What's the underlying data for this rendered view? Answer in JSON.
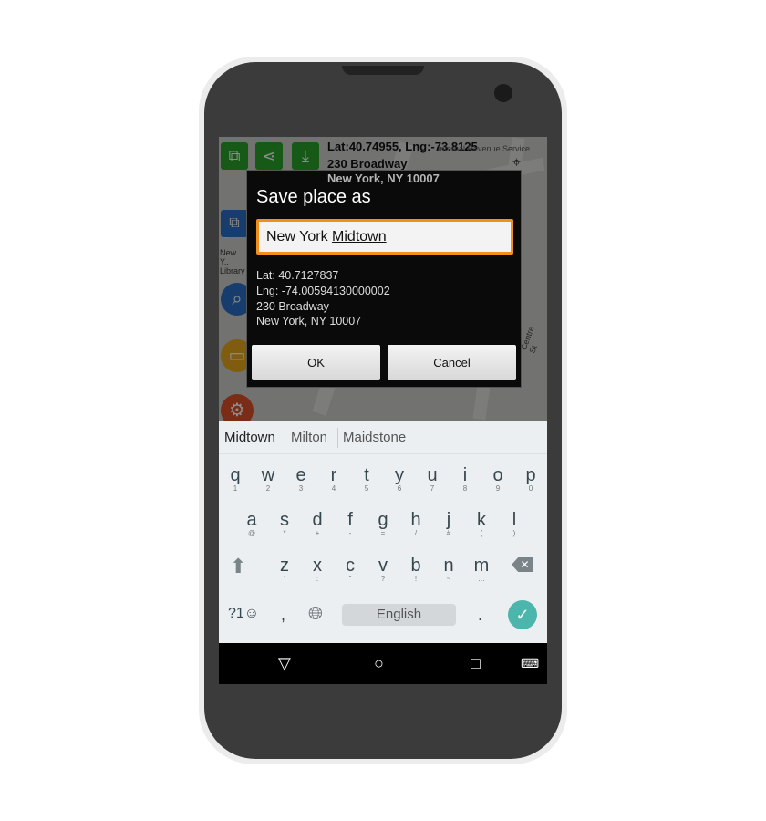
{
  "map": {
    "coords": "Lat:40.74955, Lng:-73.8125",
    "address1": "230 Broadway",
    "address2": "New York, NY 10007",
    "poi": "Internal Revenue Service",
    "side_label": "New Y.. Library",
    "street": "Centre St"
  },
  "dialog": {
    "title": "Save place as",
    "input_value_prefix": "New York ",
    "input_value_composing": "Midtown",
    "lat": "Lat: 40.7127837",
    "lng": "Lng: -74.00594130000002",
    "address1": "230 Broadway",
    "address2": "New York, NY 10007",
    "ok_label": "OK",
    "cancel_label": "Cancel",
    "accent_color": "#f0901a"
  },
  "keyboard": {
    "suggestions": [
      "Midtown",
      "Milton",
      "Maidstone"
    ],
    "row1": [
      [
        "q",
        "1"
      ],
      [
        "w",
        "2"
      ],
      [
        "e",
        "3"
      ],
      [
        "r",
        "4"
      ],
      [
        "t",
        "5"
      ],
      [
        "y",
        "6"
      ],
      [
        "u",
        "7"
      ],
      [
        "i",
        "8"
      ],
      [
        "o",
        "9"
      ],
      [
        "p",
        "0"
      ]
    ],
    "row2": [
      [
        "a",
        "@"
      ],
      [
        "s",
        "*"
      ],
      [
        "d",
        "+"
      ],
      [
        "f",
        "-"
      ],
      [
        "g",
        "="
      ],
      [
        "h",
        "/"
      ],
      [
        "j",
        "#"
      ],
      [
        "k",
        "("
      ],
      [
        "l",
        ")"
      ]
    ],
    "row3": [
      [
        "z",
        "'"
      ],
      [
        "x",
        ":"
      ],
      [
        "c",
        "\""
      ],
      [
        "v",
        "?"
      ],
      [
        "b",
        "!"
      ],
      [
        "n",
        "~"
      ],
      [
        "m",
        "…"
      ]
    ],
    "symbols_label": "?1☺",
    "comma": ",",
    "space_label": "English",
    "period": ".",
    "enter_color": "#4db6ac"
  }
}
